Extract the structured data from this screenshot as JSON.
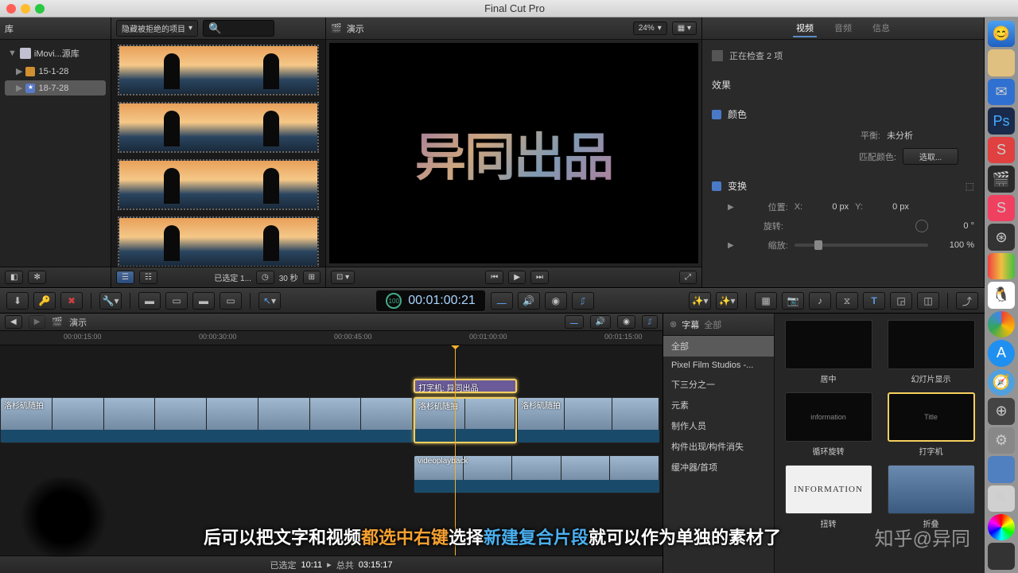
{
  "app": {
    "title": "Final Cut Pro"
  },
  "library": {
    "header": "库",
    "root": "iMovi...源库",
    "items": [
      {
        "label": "15-1-28",
        "selected": false
      },
      {
        "label": "18-7-28",
        "selected": true
      }
    ]
  },
  "browser": {
    "filter_label": "隐藏被拒绝的项目",
    "footer_selected": "已选定 1...",
    "footer_duration": "30 秒"
  },
  "viewer": {
    "title": "演示",
    "zoom": "24%",
    "title_art": "异同出品",
    "transport": {
      "prev": "⏮",
      "play": "▶",
      "next": "⏭"
    }
  },
  "inspector": {
    "tabs": {
      "video": "视频",
      "audio": "音频",
      "info": "信息"
    },
    "checking": "正在检查 2 项",
    "effects_header": "效果",
    "color": {
      "header": "颜色",
      "balance_label": "平衡:",
      "balance_value": "未分析",
      "match_label": "匹配颜色:",
      "match_btn": "选取..."
    },
    "transform": {
      "header": "变换",
      "position_label": "位置:",
      "x_label": "X:",
      "x_val": "0 px",
      "y_label": "Y:",
      "y_val": "0 px",
      "rotation_label": "旋转:",
      "rotation_val": "0 °",
      "scale_label": "缩放:",
      "scale_val": "100 %"
    }
  },
  "timecode": "00:01:00:21",
  "timecode_speed": "100",
  "timeline": {
    "title": "演示",
    "ruler": [
      "00:00:15:00",
      "00:00:30:00",
      "00:00:45:00",
      "00:01:00:00",
      "00:01:15:00"
    ],
    "clips": {
      "title_clip": "打字机: 异同出品",
      "video1_a": "洛杉矶随拍",
      "video1_b": "洛杉矶随拍",
      "video1_c": "洛杉矶随拍",
      "video2": "videoplayback"
    },
    "status": {
      "selected_label": "已选定",
      "selected_tc": "10:11",
      "total_label": "总共",
      "total_tc": "03:15:17",
      "sep": "▸"
    }
  },
  "effects": {
    "header_titles": "字幕",
    "header_all": "全部",
    "categories": [
      "全部",
      "Pixel Film Studios -...",
      "下三分之一",
      "元素",
      "制作人员",
      "构件出现/构件消失",
      "缓冲器/首项"
    ],
    "items": [
      {
        "label": "居中",
        "preview": ""
      },
      {
        "label": "幻灯片显示",
        "preview": ""
      },
      {
        "label": "循环旋转",
        "preview": "information"
      },
      {
        "label": "打字机",
        "preview": "Title",
        "selected": true
      },
      {
        "label": "扭转",
        "preview": "INFORMATION",
        "white": true
      },
      {
        "label": "折叠",
        "preview": "img"
      }
    ]
  },
  "subtitle": {
    "t1": "后可以把文字和视频",
    "t2": "都选中右键",
    "t3": "选择",
    "t4": "新建复合片段",
    "t5": "就可以作为单独的素材了"
  },
  "watermark": "知乎@异同"
}
